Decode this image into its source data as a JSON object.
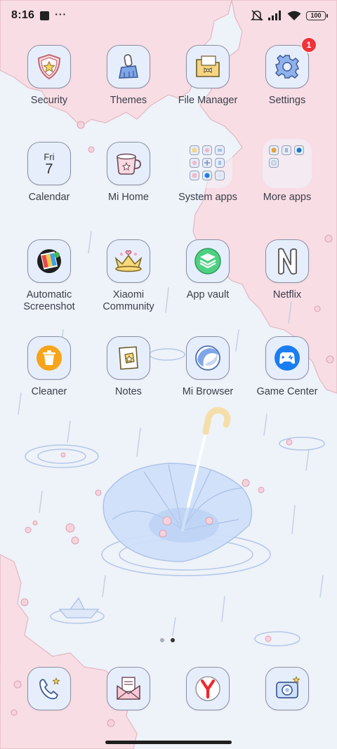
{
  "status_bar": {
    "time": "8:16",
    "notification_dots": "···",
    "battery_level": "100",
    "icons": [
      "notification-square-icon",
      "mute-icon",
      "signal-icon",
      "wifi-icon",
      "battery-icon"
    ]
  },
  "apps": [
    {
      "label": "Security",
      "icon": "shield-star-icon"
    },
    {
      "label": "Themes",
      "icon": "paintbrush-icon"
    },
    {
      "label": "File Manager",
      "icon": "folder-bow-icon"
    },
    {
      "label": "Settings",
      "icon": "gear-icon",
      "badge": "1"
    },
    {
      "label": "Calendar",
      "icon": "calendar-icon",
      "day": "Fri",
      "date": "7"
    },
    {
      "label": "Mi Home",
      "icon": "mug-icon"
    },
    {
      "label": "System apps",
      "icon": "folder-icon"
    },
    {
      "label": "More apps",
      "icon": "folder-icon"
    },
    {
      "label_line1": "Automatic",
      "label_line2": "Screenshot",
      "icon": "color-palette-icon"
    },
    {
      "label_line1": "Xiaomi",
      "label_line2": "Community",
      "icon": "crown-icon"
    },
    {
      "label": "App vault",
      "icon": "layers-icon"
    },
    {
      "label": "Netflix",
      "icon": "netflix-n-icon"
    },
    {
      "label": "Cleaner",
      "icon": "trash-can-icon"
    },
    {
      "label": "Notes",
      "icon": "notes-icon"
    },
    {
      "label": "Mi Browser",
      "icon": "browser-swirl-icon"
    },
    {
      "label": "Game Center",
      "icon": "gamepad-icon"
    }
  ],
  "dock": [
    {
      "name": "phone",
      "icon": "phone-icon"
    },
    {
      "name": "messages",
      "icon": "envelope-icon"
    },
    {
      "name": "yandex browser",
      "icon": "yandex-y-icon"
    },
    {
      "name": "camera",
      "icon": "camera-icon"
    }
  ],
  "page_indicator": {
    "pages": 2,
    "current": 2
  },
  "colors": {
    "blossom_pink": "#f8dde4",
    "sky_blue": "#eef2f9",
    "icon_fill": "#e6eefc",
    "badge_red": "#f2333a",
    "label_text": "#3b3e4a"
  }
}
